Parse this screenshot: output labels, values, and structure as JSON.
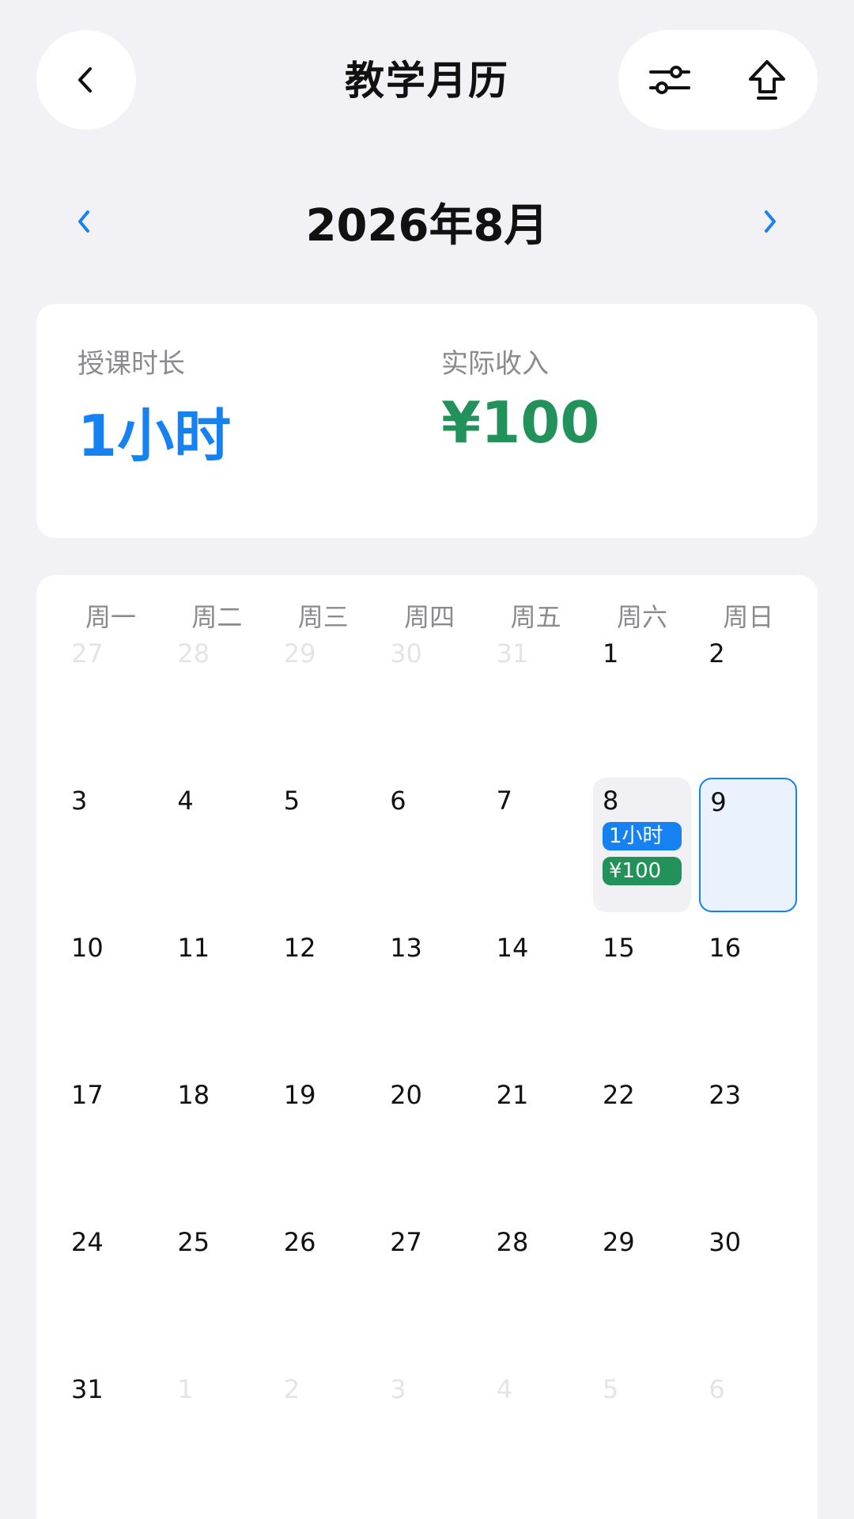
{
  "header": {
    "title": "教学月历",
    "icons": {
      "back": "chevron-left-icon",
      "filter": "sliders-icon",
      "share": "upload-arrow-icon"
    }
  },
  "month_nav": {
    "label": "2026年8月"
  },
  "summary": {
    "hours_label": "授课时长",
    "hours_value": "1小时",
    "income_label": "实际收入",
    "income_value": "¥100",
    "colors": {
      "hours": "#1682f2",
      "income": "#23915a"
    }
  },
  "calendar": {
    "weekdays": [
      "周一",
      "周二",
      "周三",
      "周四",
      "周五",
      "周六",
      "周日"
    ],
    "weeks": [
      [
        {
          "d": "27",
          "dim": true
        },
        {
          "d": "28",
          "dim": true
        },
        {
          "d": "29",
          "dim": true
        },
        {
          "d": "30",
          "dim": true
        },
        {
          "d": "31",
          "dim": true
        },
        {
          "d": "1"
        },
        {
          "d": "2"
        }
      ],
      [
        {
          "d": "3"
        },
        {
          "d": "4"
        },
        {
          "d": "5"
        },
        {
          "d": "6"
        },
        {
          "d": "7"
        },
        {
          "d": "8",
          "hours": "1小时",
          "income": "¥100"
        },
        {
          "d": "9",
          "selected": true
        }
      ],
      [
        {
          "d": "10"
        },
        {
          "d": "11"
        },
        {
          "d": "12"
        },
        {
          "d": "13"
        },
        {
          "d": "14"
        },
        {
          "d": "15"
        },
        {
          "d": "16"
        }
      ],
      [
        {
          "d": "17"
        },
        {
          "d": "18"
        },
        {
          "d": "19"
        },
        {
          "d": "20"
        },
        {
          "d": "21"
        },
        {
          "d": "22"
        },
        {
          "d": "23"
        }
      ],
      [
        {
          "d": "24"
        },
        {
          "d": "25"
        },
        {
          "d": "26"
        },
        {
          "d": "27"
        },
        {
          "d": "28"
        },
        {
          "d": "29"
        },
        {
          "d": "30"
        }
      ],
      [
        {
          "d": "31"
        },
        {
          "d": "1",
          "dim": true
        },
        {
          "d": "2",
          "dim": true
        },
        {
          "d": "3",
          "dim": true
        },
        {
          "d": "4",
          "dim": true
        },
        {
          "d": "5",
          "dim": true
        },
        {
          "d": "6",
          "dim": true
        }
      ]
    ]
  }
}
